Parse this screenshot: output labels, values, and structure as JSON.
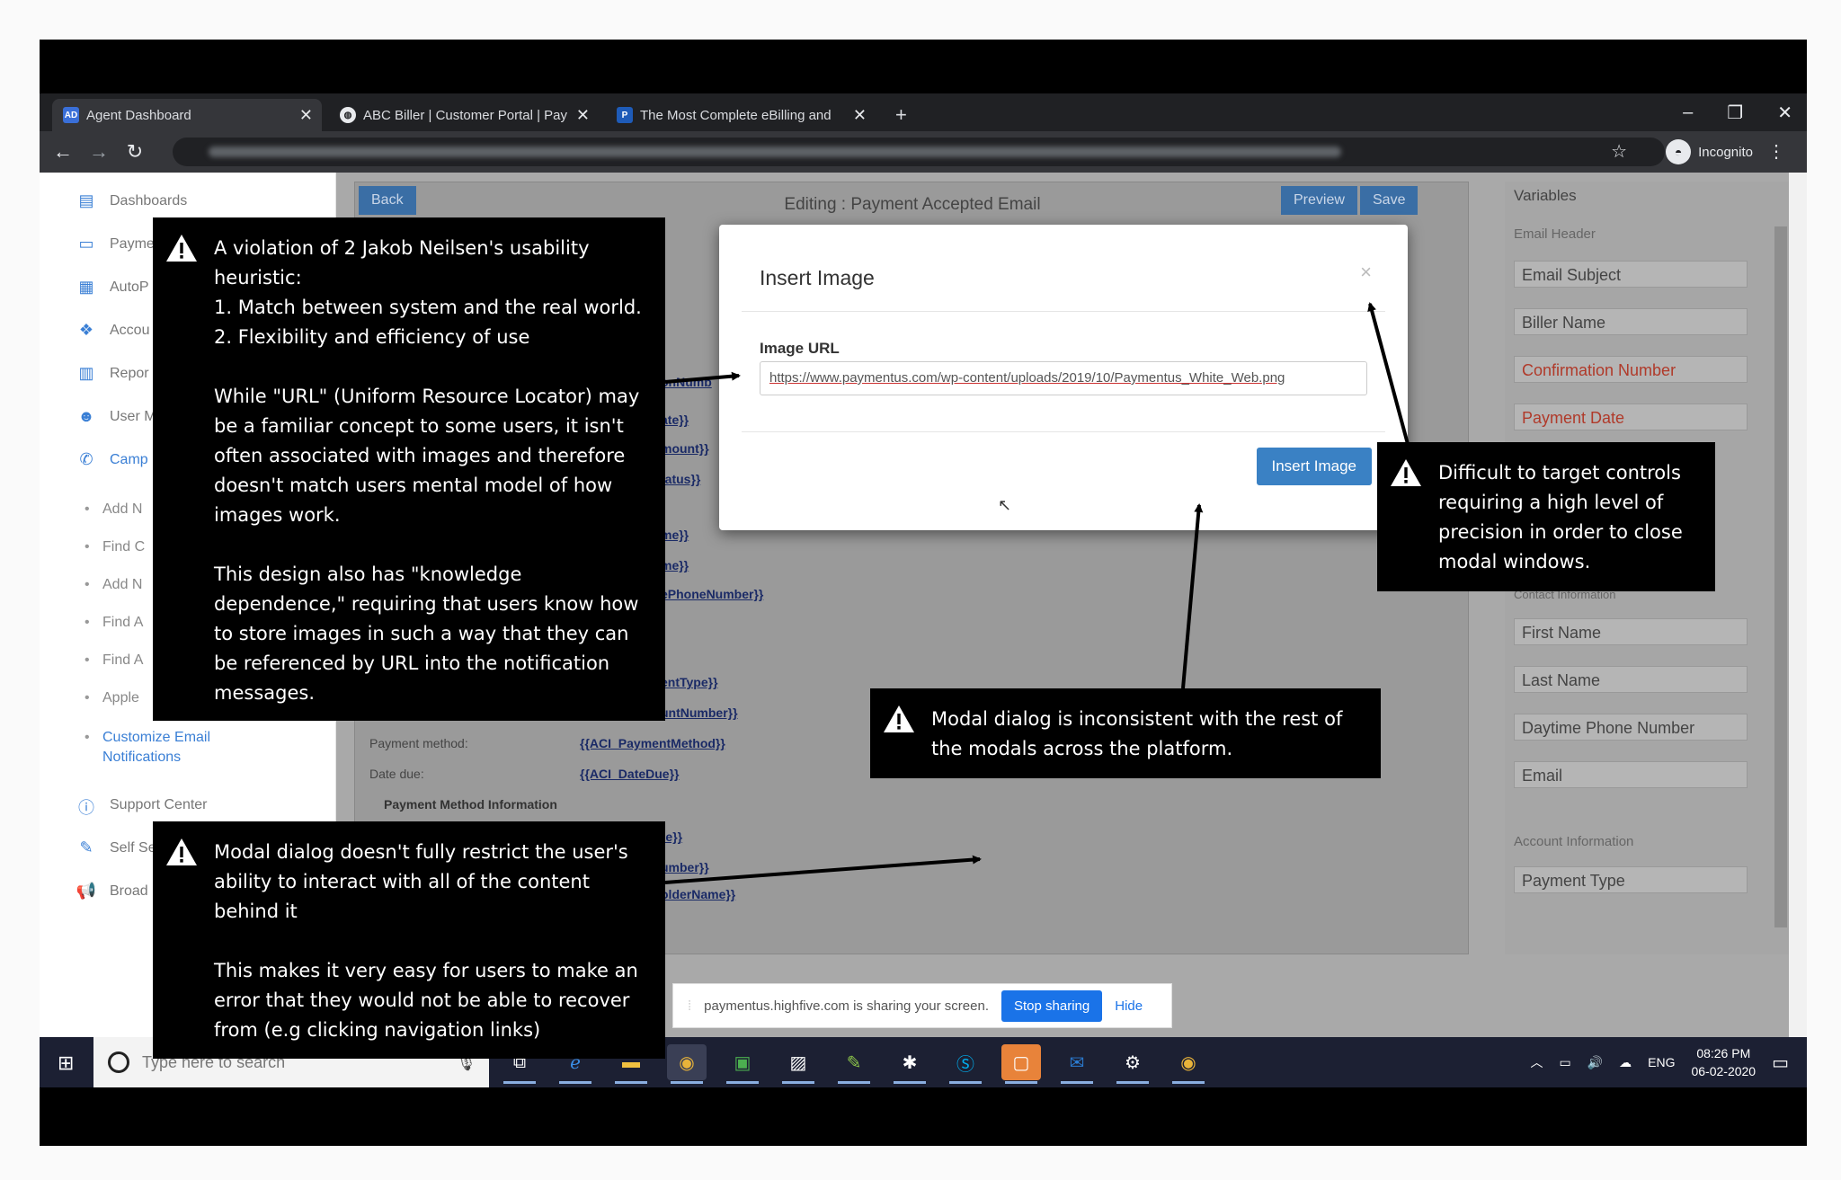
{
  "browser": {
    "tabs": [
      {
        "favicon": "AD",
        "title": "Agent Dashboard"
      },
      {
        "favicon": "globe-icon",
        "title": "ABC Biller | Customer Portal | Pay"
      },
      {
        "favicon": "P",
        "title": "The Most Complete eBilling and"
      }
    ],
    "new_tab": "+",
    "incognito_label": "Incognito"
  },
  "sidebar": {
    "items": [
      "Dashboards",
      "Payme",
      "AutoP",
      "Accou",
      "Repor",
      "User M",
      "Camp"
    ],
    "subitems": [
      "Add N",
      "Find C",
      "Add N",
      "Find A",
      "Find A",
      "Apple"
    ],
    "current_sub": "Customize Email\nNotifications",
    "bottom_items": [
      "Support Center",
      "Self Se",
      "Broad"
    ]
  },
  "editor": {
    "back_label": "Back",
    "title": "Editing : Payment Accepted Email",
    "preview_label": "Preview",
    "save_label": "Save",
    "template_fields": [
      "onNumb",
      "ate}}",
      "mount}}",
      "tatus}}",
      "me}}",
      "me}}",
      "ePhoneNumber}}",
      "entType}}",
      "untNumber}}"
    ],
    "payment_method_label": "Payment method:",
    "payment_method_value": "{{ACI_PaymentMethod}}",
    "date_due_label": "Date due:",
    "date_due_value": "{{ACI_DateDue}}",
    "payment_method_info": "Payment Method Information",
    "lower_fields": [
      "{{PM_CardType}}",
      "umber}}",
      "olderName}}"
    ]
  },
  "variables": {
    "title": "Variables",
    "email_header": "Email Header",
    "header_fields": [
      {
        "label": "Email Subject",
        "red": false
      },
      {
        "label": "Biller Name",
        "red": false
      },
      {
        "label": "Confirmation Number",
        "red": true
      },
      {
        "label": "Payment Date",
        "red": true
      }
    ],
    "contact_section": "Contact Information",
    "contact_fields": [
      "First Name",
      "Last Name",
      "Daytime Phone Number",
      "Email"
    ],
    "account_section": "Account Information",
    "account_fields": [
      "Payment Type"
    ]
  },
  "modal": {
    "title": "Insert Image",
    "close": "×",
    "field_label": "Image URL",
    "field_value": "https://www.paymentus.com/wp-content/uploads/2019/10/Paymentus_White_Web.png",
    "insert_label": "Insert Image"
  },
  "sharing_bar": {
    "text": "paymentus.highfive.com is sharing your screen.",
    "stop_label": "Stop sharing",
    "hide_label": "Hide"
  },
  "taskbar": {
    "search_placeholder": "Type here to search",
    "lang": "ENG",
    "time": "08:26 PM",
    "date": "06-02-2020"
  },
  "annotations": {
    "heuristics": "A violation of 2 Jakob Neilsen's usability heuristic:\n1. Match between system and the real world.\n2. Flexibility and efficiency of use\n\nWhile \"URL\" (Uniform Resource Locator) may be a familiar concept to some users, it isn't often associated with images and therefore doesn't match users mental model of how images work.\n\nThis design also has \"knowledge dependence,\" requiring that users know how to store images in such a way that they can be referenced by URL into the notification messages.",
    "target": "Difficult to target controls requiring a high level of precision in order to close modal windows.",
    "inconsistent": "Modal dialog is inconsistent with the rest of the modals across the platform.",
    "restrict": "Modal dialog doesn't fully restrict the user's ability to interact with all of the content behind it\n\nThis makes it very easy for users to make an error that they would not be able to recover from (e.g clicking navigation links)"
  }
}
